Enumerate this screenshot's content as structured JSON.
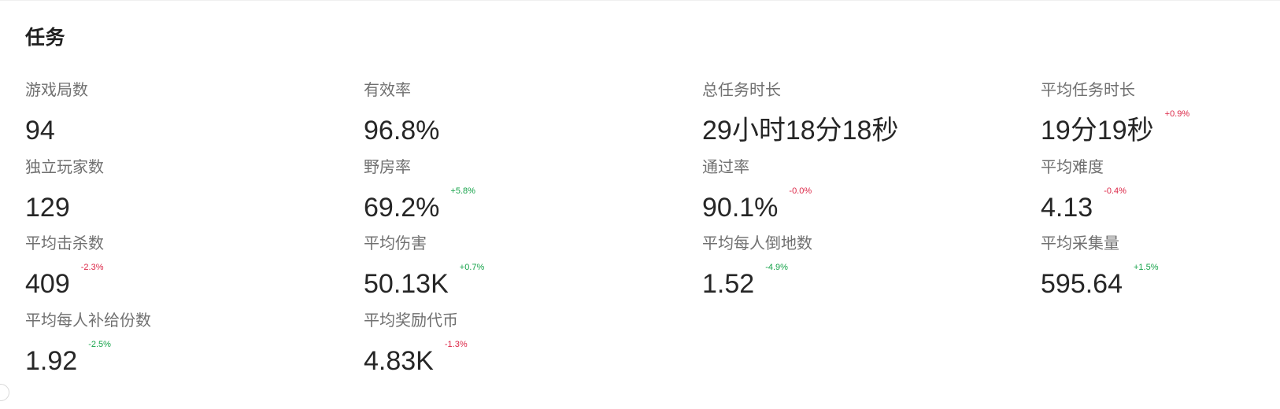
{
  "section": {
    "title": "任务"
  },
  "colors": {
    "positive": "#16a34a",
    "negative": "#dc2646"
  },
  "stats": [
    {
      "label": "游戏局数",
      "value": "94",
      "change": "",
      "trend": ""
    },
    {
      "label": "有效率",
      "value": "96.8%",
      "change": "",
      "trend": ""
    },
    {
      "label": "总任务时长",
      "value": "29小时18分18秒",
      "change": "",
      "trend": ""
    },
    {
      "label": "平均任务时长",
      "value": "19分19秒",
      "change": "+0.9%",
      "trend": "down"
    },
    {
      "label": "独立玩家数",
      "value": "129",
      "change": "",
      "trend": ""
    },
    {
      "label": "野房率",
      "value": "69.2%",
      "change": "+5.8%",
      "trend": "up"
    },
    {
      "label": "通过率",
      "value": "90.1%",
      "change": "-0.0%",
      "trend": "down"
    },
    {
      "label": "平均难度",
      "value": "4.13",
      "change": "-0.4%",
      "trend": "down"
    },
    {
      "label": "平均击杀数",
      "value": "409",
      "change": "-2.3%",
      "trend": "down"
    },
    {
      "label": "平均伤害",
      "value": "50.13K",
      "change": "+0.7%",
      "trend": "up"
    },
    {
      "label": "平均每人倒地数",
      "value": "1.52",
      "change": "-4.9%",
      "trend": "up"
    },
    {
      "label": "平均采集量",
      "value": "595.64",
      "change": "+1.5%",
      "trend": "up"
    },
    {
      "label": "平均每人补给份数",
      "value": "1.92",
      "change": "-2.5%",
      "trend": "up"
    },
    {
      "label": "平均奖励代币",
      "value": "4.83K",
      "change": "-1.3%",
      "trend": "down"
    }
  ]
}
